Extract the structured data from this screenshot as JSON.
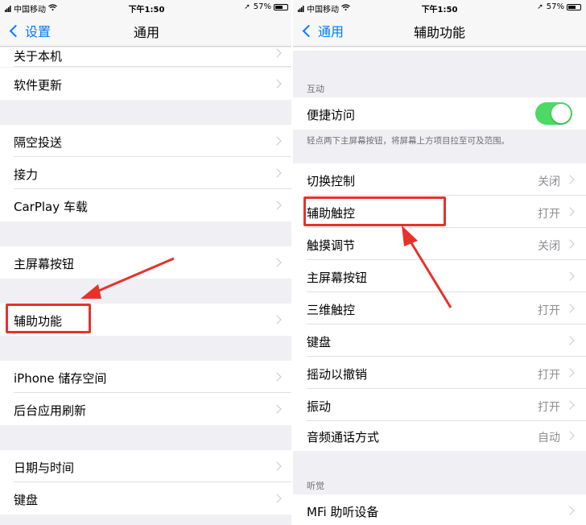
{
  "left": {
    "status": {
      "carrier": "中国移动",
      "time": "下午1:50",
      "battery": "57%"
    },
    "nav": {
      "back_label": "设置",
      "title": "通用"
    },
    "groups": [
      [
        "关于本机",
        "软件更新"
      ],
      [
        "隔空投送",
        "接力",
        "CarPlay 车载"
      ],
      [
        "主屏幕按钮"
      ],
      [
        "辅助功能"
      ],
      [
        "iPhone 储存空间",
        "后台应用刷新"
      ],
      [
        "日期与时间",
        "键盘"
      ]
    ]
  },
  "right": {
    "status": {
      "carrier": "中国移动",
      "time": "下午1:50",
      "battery": "57%"
    },
    "nav": {
      "back_label": "通用",
      "title": "辅助功能"
    },
    "section_interaction": "互动",
    "shortcut_label": "便捷访问",
    "shortcut_on": true,
    "shortcut_footer": "轻点两下主屏幕按钮，将屏幕上方项目拉至可及范围。",
    "items": [
      {
        "label": "切换控制",
        "value": "关闭"
      },
      {
        "label": "辅助触控",
        "value": "打开"
      },
      {
        "label": "触摸调节",
        "value": "关闭"
      },
      {
        "label": "主屏幕按钮",
        "value": ""
      },
      {
        "label": "三维触控",
        "value": "打开"
      },
      {
        "label": "键盘",
        "value": ""
      },
      {
        "label": "摇动以撤销",
        "value": "打开"
      },
      {
        "label": "振动",
        "value": "打开"
      },
      {
        "label": "音频通话方式",
        "value": "自动"
      }
    ],
    "section_hearing": "听觉",
    "hearing_items": [
      {
        "label": "MFi 助听设备",
        "value": ""
      }
    ]
  },
  "colors": {
    "accent": "#007aff",
    "toggle_on": "#4cd964",
    "highlight": "#e8312a"
  }
}
